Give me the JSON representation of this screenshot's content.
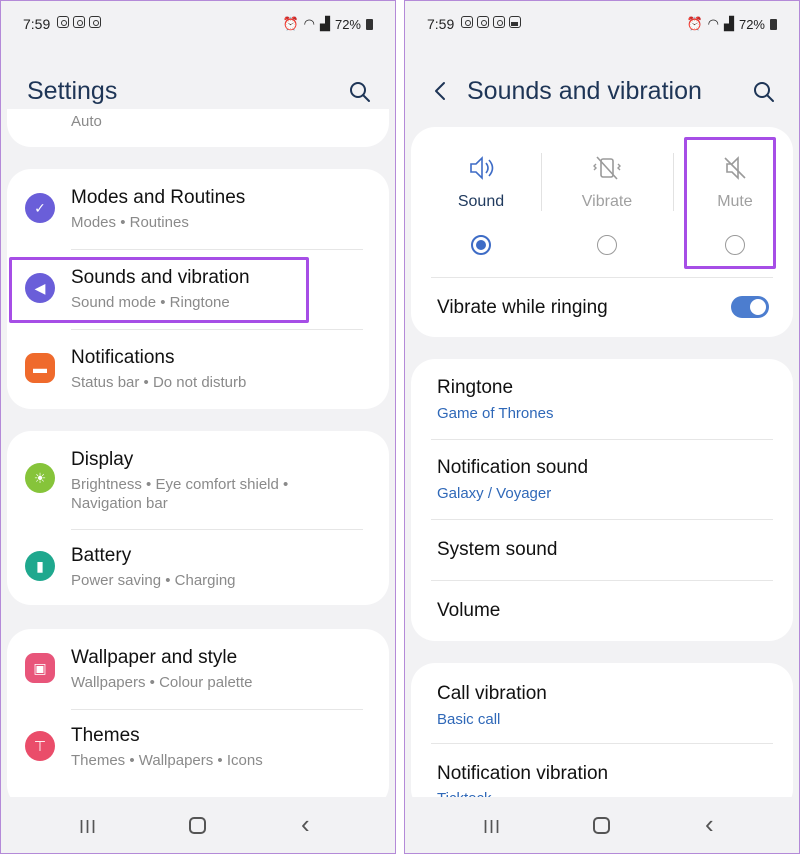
{
  "status": {
    "time": "7:59",
    "battery": "72%"
  },
  "left": {
    "title": "Settings",
    "partial_item_sub": "Auto",
    "items": [
      {
        "title": "Modes and Routines",
        "sub1": "Modes",
        "sub2": "Routines",
        "color": "#6a5ed9"
      },
      {
        "title": "Sounds and vibration",
        "sub1": "Sound mode",
        "sub2": "Ringtone",
        "color": "#6a5ed9"
      },
      {
        "title": "Notifications",
        "sub1": "Status bar",
        "sub2": "Do not disturb",
        "color": "#ef6a2c"
      },
      {
        "title": "Display",
        "sub1": "Brightness",
        "sub2": "Eye comfort shield",
        "sub3": "Navigation bar",
        "color": "#86c43a"
      },
      {
        "title": "Battery",
        "sub1": "Power saving",
        "sub2": "Charging",
        "color": "#1fa88e"
      },
      {
        "title": "Wallpaper and style",
        "sub1": "Wallpapers",
        "sub2": "Colour palette",
        "color": "#e8557a"
      },
      {
        "title": "Themes",
        "sub1": "Themes",
        "sub2": "Wallpapers",
        "sub3": "Icons",
        "color": "#ea4d6a"
      }
    ]
  },
  "right": {
    "title": "Sounds and vibration",
    "modes": [
      {
        "label": "Sound",
        "selected": true
      },
      {
        "label": "Vibrate",
        "selected": false
      },
      {
        "label": "Mute",
        "selected": false
      }
    ],
    "vibrate_while_ringing": {
      "label": "Vibrate while ringing",
      "on": true
    },
    "settings": [
      {
        "title": "Ringtone",
        "value": "Game of Thrones"
      },
      {
        "title": "Notification sound",
        "value": "Galaxy / Voyager"
      },
      {
        "title": "System sound"
      },
      {
        "title": "Volume"
      }
    ],
    "vibration": [
      {
        "title": "Call vibration",
        "value": "Basic call"
      },
      {
        "title": "Notification vibration",
        "value": "Ticktock"
      }
    ]
  },
  "colors": {
    "accent": "#3e6cc6",
    "highlight": "#a64ee6",
    "title": "#1e3556"
  },
  "icons": {
    "search": "search-icon",
    "back": "back-arrow-icon",
    "nav_recent": "recent-apps-icon",
    "nav_home": "home-icon",
    "nav_back": "nav-back-icon"
  },
  "nav": {
    "recent": "III",
    "back": "‹"
  }
}
